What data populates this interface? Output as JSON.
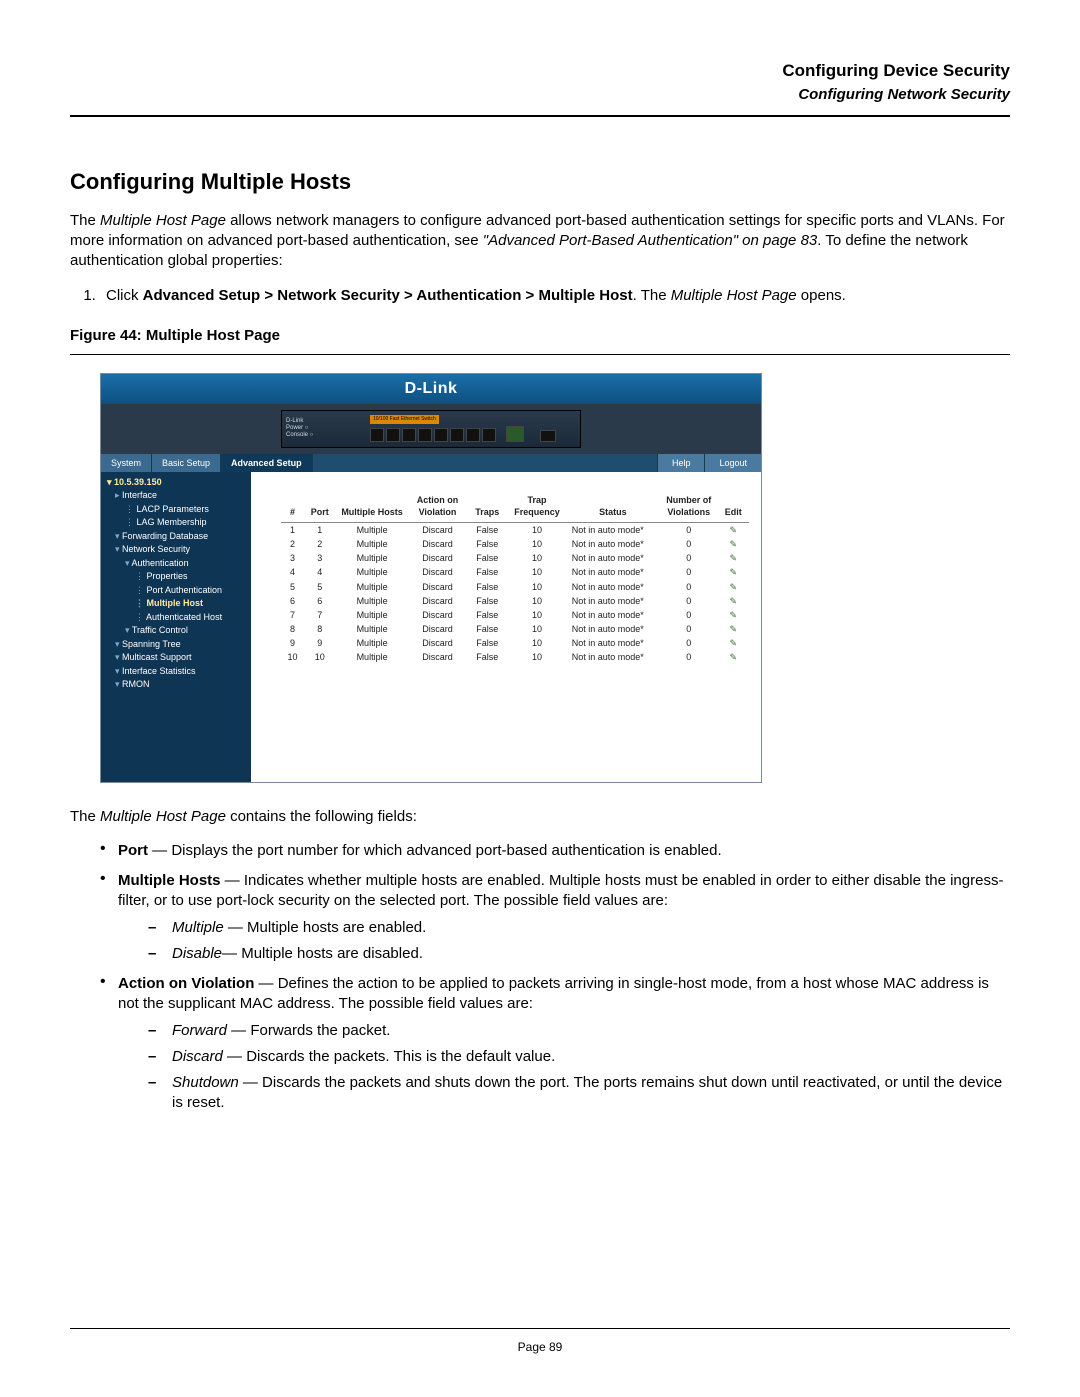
{
  "header": {
    "line1": "Configuring Device Security",
    "line2": "Configuring Network Security"
  },
  "section_title": "Configuring Multiple Hosts",
  "intro": {
    "pre": "The ",
    "page_name": "Multiple Host Page",
    "mid": " allows network managers to configure advanced port-based authentication settings for specific ports and VLANs. For more information on advanced port-based authentication, see ",
    "ref": "\"Advanced Port-Based Authentication\" on page 83",
    "post": ". To define the network authentication global properties:"
  },
  "step1": {
    "lead": "Click ",
    "path": "Advanced Setup > Network Security > Authentication > Multiple Host",
    "mid": ". The ",
    "page_name": "Multiple Host Page",
    "post": " opens."
  },
  "figure_caption": "Figure 44:  Multiple Host Page",
  "shot": {
    "brand": "D-Link",
    "device_label": "10/100 Fast Ethernet Switch",
    "tabs": {
      "system": "System",
      "basic": "Basic Setup",
      "advanced": "Advanced Setup"
    },
    "buttons": {
      "help": "Help",
      "logout": "Logout"
    },
    "tree": {
      "ip": "10.5.39.150",
      "items": [
        "Interface",
        "LACP Parameters",
        "LAG Membership",
        "Forwarding Database",
        "Network Security",
        "Authentication",
        "Properties",
        "Port Authentication",
        "Multiple Host",
        "Authenticated Host",
        "Traffic Control",
        "Spanning Tree",
        "Multicast Support",
        "Interface Statistics",
        "RMON"
      ]
    },
    "table": {
      "headers": [
        "#",
        "Port",
        "Multiple Hosts",
        "Action on Violation",
        "Traps",
        "Trap Frequency",
        "Status",
        "Number of Violations",
        "Edit"
      ],
      "rows": [
        {
          "n": "1",
          "port": "1",
          "mh": "Multiple",
          "aov": "Discard",
          "traps": "False",
          "tf": "10",
          "status": "Not in auto mode*",
          "nv": "0"
        },
        {
          "n": "2",
          "port": "2",
          "mh": "Multiple",
          "aov": "Discard",
          "traps": "False",
          "tf": "10",
          "status": "Not in auto mode*",
          "nv": "0"
        },
        {
          "n": "3",
          "port": "3",
          "mh": "Multiple",
          "aov": "Discard",
          "traps": "False",
          "tf": "10",
          "status": "Not in auto mode*",
          "nv": "0"
        },
        {
          "n": "4",
          "port": "4",
          "mh": "Multiple",
          "aov": "Discard",
          "traps": "False",
          "tf": "10",
          "status": "Not in auto mode*",
          "nv": "0"
        },
        {
          "n": "5",
          "port": "5",
          "mh": "Multiple",
          "aov": "Discard",
          "traps": "False",
          "tf": "10",
          "status": "Not in auto mode*",
          "nv": "0"
        },
        {
          "n": "6",
          "port": "6",
          "mh": "Multiple",
          "aov": "Discard",
          "traps": "False",
          "tf": "10",
          "status": "Not in auto mode*",
          "nv": "0"
        },
        {
          "n": "7",
          "port": "7",
          "mh": "Multiple",
          "aov": "Discard",
          "traps": "False",
          "tf": "10",
          "status": "Not in auto mode*",
          "nv": "0"
        },
        {
          "n": "8",
          "port": "8",
          "mh": "Multiple",
          "aov": "Discard",
          "traps": "False",
          "tf": "10",
          "status": "Not in auto mode*",
          "nv": "0"
        },
        {
          "n": "9",
          "port": "9",
          "mh": "Multiple",
          "aov": "Discard",
          "traps": "False",
          "tf": "10",
          "status": "Not in auto mode*",
          "nv": "0"
        },
        {
          "n": "10",
          "port": "10",
          "mh": "Multiple",
          "aov": "Discard",
          "traps": "False",
          "tf": "10",
          "status": "Not in auto mode*",
          "nv": "0"
        }
      ]
    }
  },
  "desc_lead": {
    "pre": "The ",
    "page_name": "Multiple Host Page",
    "post": " contains the following fields:"
  },
  "fields": {
    "port": {
      "name": "Port",
      "text": " — Displays the port number for which advanced port-based authentication is enabled."
    },
    "mh": {
      "name": "Multiple Hosts",
      "text": " — Indicates whether multiple hosts are enabled. Multiple hosts must be enabled in order to either disable the ingress-filter, or to use port-lock security on the selected port. The possible field values are:",
      "opts": [
        {
          "k": "Multiple",
          "v": " — Multiple hosts are enabled."
        },
        {
          "k": "Disable",
          "v": "— Multiple hosts are disabled."
        }
      ]
    },
    "aov": {
      "name": "Action on Violation",
      "text": " — Defines the action to be applied to packets arriving in single-host mode, from a host whose MAC address is not the supplicant MAC address. The possible field values are:",
      "opts": [
        {
          "k": "Forward",
          "v": " — Forwards the packet."
        },
        {
          "k": "Discard",
          "v": " — Discards the packets. This is the default value."
        },
        {
          "k": "Shutdown",
          "v": " — Discards the packets and shuts down the port. The ports remains shut down until reactivated, or until the device is reset."
        }
      ]
    }
  },
  "footer": "Page 89"
}
